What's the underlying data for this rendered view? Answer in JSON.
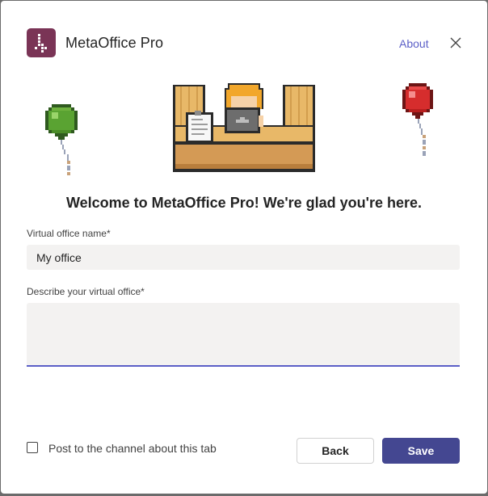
{
  "header": {
    "app_name": "MetaOffice Pro",
    "about_label": "About"
  },
  "welcome_text": "Welcome to MetaOffice Pro! We're glad you're here.",
  "form": {
    "name_label": "Virtual office name*",
    "name_value": "My office",
    "description_label": "Describe your virtual office*",
    "description_value": ""
  },
  "footer": {
    "post_checkbox_label": "Post to the channel about this tab",
    "post_checked": false,
    "back_label": "Back",
    "save_label": "Save"
  },
  "colors": {
    "brand": "#7a3456",
    "accent": "#5b5fc7",
    "primary_button": "#444791"
  },
  "icons": {
    "app": "metaoffice-logo-icon",
    "close": "close-icon",
    "hero": "pixel-office-desk-illustration"
  }
}
